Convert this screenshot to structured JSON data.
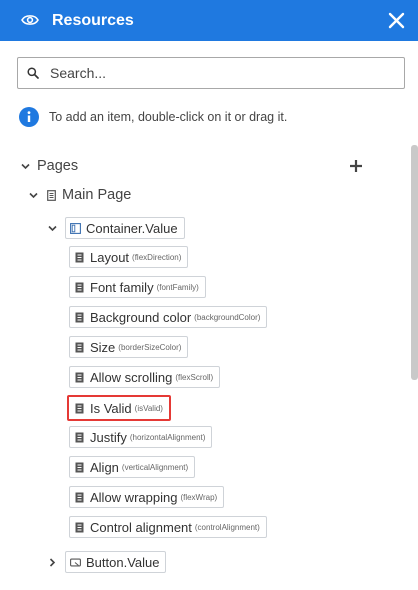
{
  "header": {
    "title": "Resources",
    "eye_icon": "eye-icon",
    "close_icon": "close-icon"
  },
  "search": {
    "placeholder": "Search...",
    "value": ""
  },
  "info": {
    "text": "To add an item, double-click on it or drag it."
  },
  "tree": {
    "pages_label": "Pages",
    "main_page_label": "Main Page",
    "container": {
      "label": "Container.Value"
    },
    "properties": [
      {
        "label": "Layout",
        "sub": "(flexDirection)"
      },
      {
        "label": "Font family",
        "sub": "(fontFamily)"
      },
      {
        "label": "Background color",
        "sub": "(backgroundColor)"
      },
      {
        "label": "Size",
        "sub": "(borderSizeColor)"
      },
      {
        "label": "Allow scrolling",
        "sub": "(flexScroll)"
      },
      {
        "label": "Is Valid",
        "sub": "(isValid)"
      },
      {
        "label": "Justify",
        "sub": "(horizontalAlignment)"
      },
      {
        "label": "Align",
        "sub": "(verticalAlignment)"
      },
      {
        "label": "Allow wrapping",
        "sub": "(flexWrap)"
      },
      {
        "label": "Control alignment",
        "sub": "(controlAlignment)"
      }
    ],
    "button": {
      "label": "Button.Value"
    }
  },
  "colors": {
    "accent": "#1f79e0",
    "highlight": "#e53935"
  }
}
